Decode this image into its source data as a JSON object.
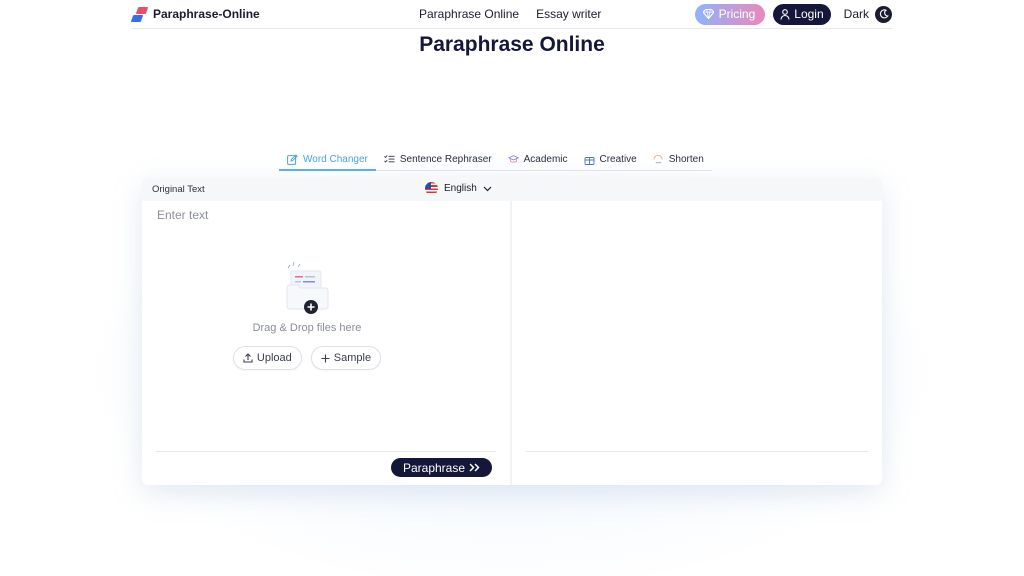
{
  "header": {
    "brand": "Paraphrase-Online",
    "nav": [
      "Paraphrase Online",
      "Essay writer"
    ],
    "pricing_label": "Pricing",
    "login_label": "Login",
    "theme_label": "Dark"
  },
  "page_title": "Paraphrase Online",
  "tabs": [
    {
      "label": "Word Changer",
      "icon": "edit-icon",
      "active": true
    },
    {
      "label": "Sentence Rephraser",
      "icon": "list-check-icon",
      "active": false
    },
    {
      "label": "Academic",
      "icon": "graduation-cap-icon",
      "active": false
    },
    {
      "label": "Creative",
      "icon": "gift-icon",
      "active": false
    },
    {
      "label": "Shorten",
      "icon": "shorten-icon",
      "active": false
    }
  ],
  "editor": {
    "original_label": "Original Text",
    "language": "English",
    "input_placeholder": "Enter text",
    "drop_text": "Drag & Drop files here",
    "upload_label": "Upload",
    "sample_label": "Sample",
    "paraphrase_label": "Paraphrase"
  },
  "colors": {
    "primary_dark": "#14163a",
    "active_tab": "#4aa3e0",
    "pricing_gradient_start": "#8fb3ff",
    "pricing_gradient_end": "#e889b8"
  }
}
